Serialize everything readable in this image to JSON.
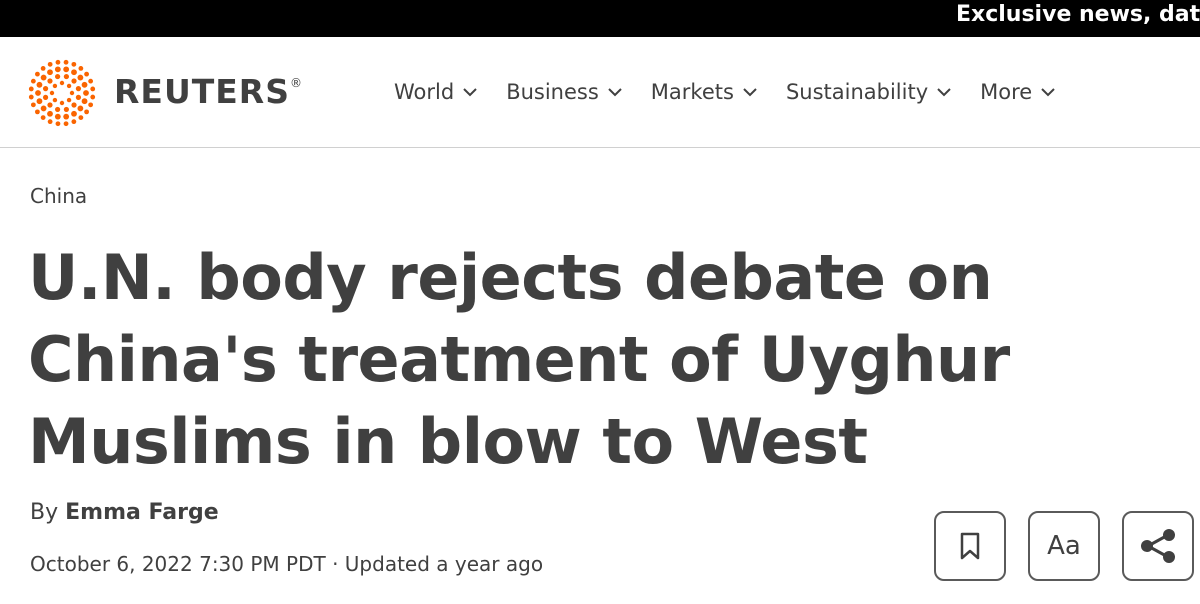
{
  "topbar": {
    "promo_text": "Exclusive news, data ar"
  },
  "header": {
    "logo_text": "REUTERS",
    "logo_reg": "®",
    "nav": [
      {
        "label": "World"
      },
      {
        "label": "Business"
      },
      {
        "label": "Markets"
      },
      {
        "label": "Sustainability"
      },
      {
        "label": "More"
      }
    ]
  },
  "article": {
    "section": "China",
    "headline": "U.N. body rejects debate on China's treatment of Uyghur Muslims in blow to West",
    "byline_prefix": "By",
    "author": "Emma Farge",
    "date": "October 6, 2022 7:30 PM PDT",
    "separator": "·",
    "updated": "Updated a year ago"
  },
  "tools": {
    "bookmark_icon": "bookmark-icon",
    "text_size_label": "Aa",
    "share_icon": "share-icon"
  },
  "colors": {
    "brand_orange": "#fa6400",
    "text": "#404040",
    "topbar_bg": "#000000"
  }
}
